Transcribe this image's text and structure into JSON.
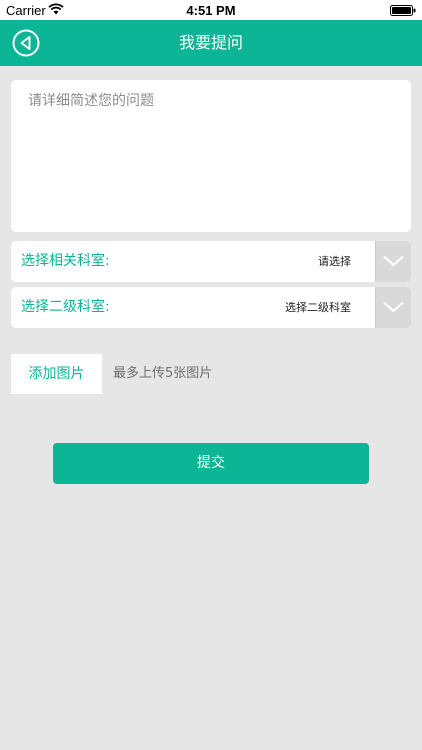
{
  "status_bar": {
    "carrier": "Carrier",
    "time": "4:51 PM"
  },
  "nav": {
    "title": "我要提问",
    "back_icon": "back-arrow-circle-icon"
  },
  "question": {
    "placeholder": "请详细简述您的问题",
    "value": ""
  },
  "department": {
    "label": "选择相关科室:",
    "value": "请选择"
  },
  "sub_department": {
    "label": "选择二级科室:",
    "value": "选择二级科室"
  },
  "images": {
    "add_label": "添加图片",
    "hint": "最多上传5张图片"
  },
  "submit": {
    "label": "提交"
  },
  "colors": {
    "accent": "#0cb596",
    "background": "#e6e6e6"
  }
}
